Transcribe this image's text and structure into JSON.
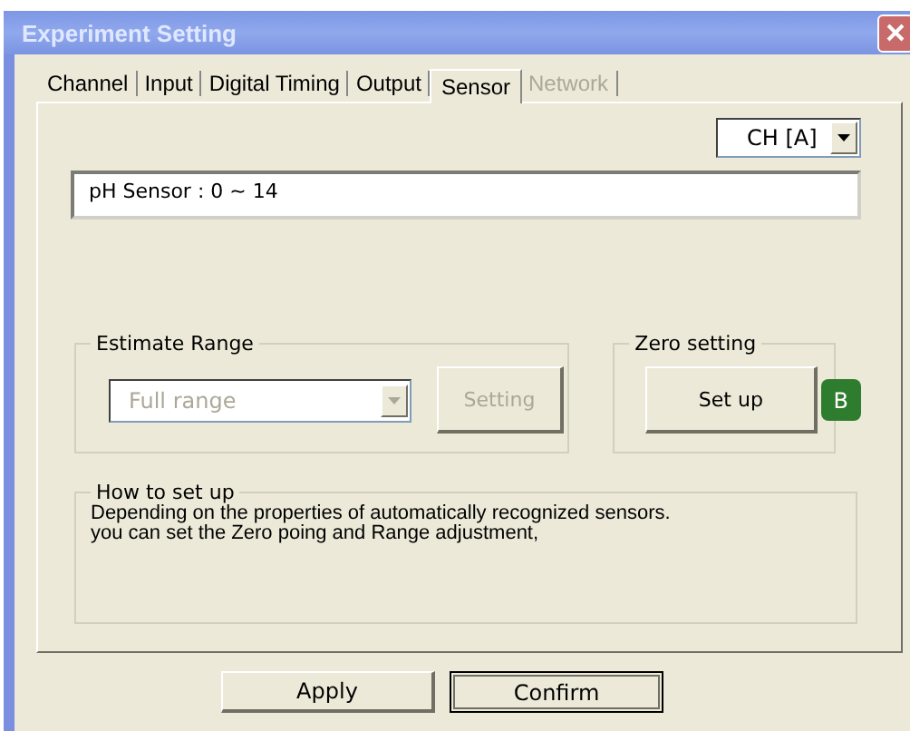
{
  "window": {
    "title": "Experiment Setting"
  },
  "tabs": [
    {
      "label": "Channel",
      "selected": false,
      "disabled": false
    },
    {
      "label": "Input",
      "selected": false,
      "disabled": false
    },
    {
      "label": "Digital Timing",
      "selected": false,
      "disabled": false
    },
    {
      "label": "Output",
      "selected": false,
      "disabled": false
    },
    {
      "label": "Sensor",
      "selected": true,
      "disabled": false
    },
    {
      "label": "Network",
      "selected": false,
      "disabled": true
    }
  ],
  "channel_select": {
    "value": "CH [A]"
  },
  "sensor_info": {
    "value": "pH Sensor : 0 ~ 14"
  },
  "estimate_range": {
    "title": "Estimate Range",
    "dropdown": {
      "value": "Full range",
      "disabled": true
    },
    "button": {
      "label": "Setting",
      "disabled": true
    }
  },
  "zero_setting": {
    "title": "Zero setting",
    "button": {
      "label": "Set up",
      "disabled": false
    },
    "badge": "B"
  },
  "how_to": {
    "title": "How to set up",
    "lines": [
      "Depending on the properties of automatically recognized sensors.",
      "you can set the Zero poing and Range adjustment,"
    ]
  },
  "buttons": [
    {
      "label": "Apply",
      "default": false
    },
    {
      "label": "Confirm",
      "default": true
    }
  ]
}
